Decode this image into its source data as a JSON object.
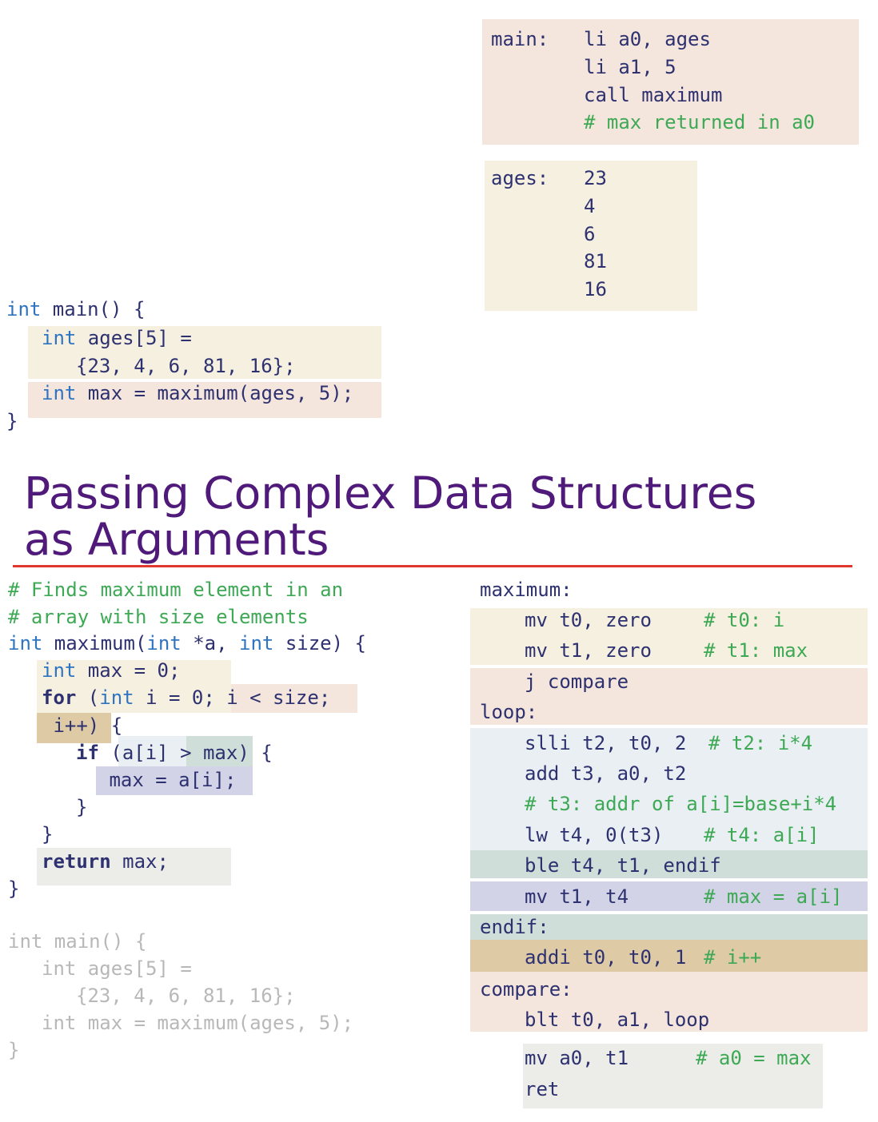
{
  "title": {
    "line1": "Passing Complex Data Structures",
    "line2": "as Arguments"
  },
  "top_asm_main": {
    "label": "main:",
    "lines": [
      "li a0, ages",
      "li a1, 5",
      "call maximum"
    ],
    "comment": "# max returned in a0"
  },
  "top_asm_ages": {
    "label": "ages:",
    "values": [
      "23",
      "4",
      "6",
      "81",
      "16"
    ]
  },
  "top_c_main": {
    "l1_kw": "int",
    "l1_rest": " main() {",
    "l2_kw": "int",
    "l2_rest": " ages[5] =",
    "l3": "{23, 4, 6, 81, 16};",
    "l4_kw": "int",
    "l4_rest": " max = maximum(ages, 5);",
    "l5": "}"
  },
  "c_maximum": {
    "comment1": "# Finds maximum element in an",
    "comment2": "# array with size elements",
    "sig_kw1": "int",
    "sig_name": " maximum(",
    "sig_kw2": "int",
    "sig_a": " *a, ",
    "sig_kw3": "int",
    "sig_end": " size) {",
    "init_kw": "int",
    "init_rest": " max = 0;",
    "for_kw": "for",
    "for_paren": " (",
    "for_kw2": "int",
    "for_init": " i = 0;",
    "for_cond": " i < size;",
    "for_inc": " i++)",
    "for_brace": " {",
    "if_kw": "if",
    "if_open": " (",
    "if_ai": "a[i] ",
    "if_cmp": "> max",
    "if_close": ") {",
    "assign": " max = a[i];",
    "close_inner": "}",
    "close_for": "}",
    "ret_kw": "return",
    "ret_rest": " max;",
    "close_fn": "}"
  },
  "c_main_faded": {
    "l1": "int main() {",
    "l2": "int ages[5] =",
    "l3": "{23, 4, 6, 81, 16};",
    "l4": "int max = maximum(ages, 5);",
    "l5": "}"
  },
  "asm_maximum": {
    "label_maximum": "maximum:",
    "mv_t0": "mv t0, zero",
    "mv_t0_cm": "# t0: i",
    "mv_t1": "mv t1, zero",
    "mv_t1_cm": "# t1: max",
    "j_compare": "j compare",
    "label_loop": "loop:",
    "slli": "slli t2, t0, 2",
    "slli_cm": "# t2: i*4",
    "add": "add t3, a0, t2",
    "add_cm": "# t3: addr of a[i]=base+i*4",
    "lw": "lw t4, 0(t3)",
    "lw_cm": "# t4: a[i]",
    "ble": "ble t4, t1, endif",
    "mv_t1_t4": "mv t1, t4",
    "mv_t1_t4_cm": "# max = a[i]",
    "label_endif": "endif:",
    "addi": "addi t0, t0, 1",
    "addi_cm": "# i++",
    "label_compare": "compare:",
    "blt": "blt t0, a1, loop",
    "mv_a0": "mv a0, t1",
    "mv_a0_cm": "# a0 = max",
    "ret": "ret"
  }
}
